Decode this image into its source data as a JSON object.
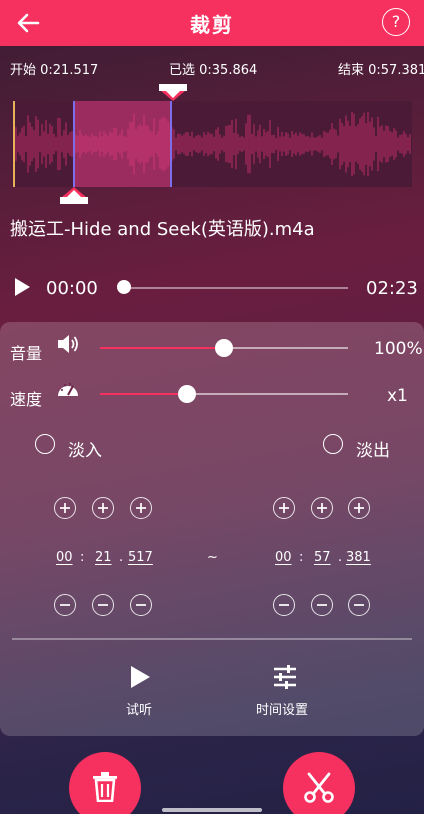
{
  "header": {
    "title": "裁剪",
    "help_label": "?"
  },
  "times": {
    "start": "开始 0:21.517",
    "selected": "已选 0:35.864",
    "end": "结束 0:57.381"
  },
  "file": {
    "name": "搬运工-Hide and Seek(英语版).m4a"
  },
  "player": {
    "current": "00:00",
    "total": "02:23",
    "progress": 0.0
  },
  "volume": {
    "label": "音量",
    "value": "100%",
    "level": 0.5
  },
  "speed": {
    "label": "速度",
    "value": "x1",
    "level": 0.35
  },
  "fade_in": {
    "label": "淡入",
    "checked": false
  },
  "fade_out": {
    "label": "淡出",
    "checked": false
  },
  "start_time": {
    "hh": "00",
    "mm": "21",
    "ms": "517"
  },
  "end_time": {
    "hh": "00",
    "mm": "57",
    "ms": "381"
  },
  "time_separator": "~",
  "actions": {
    "preview": "试听",
    "time_settings": "时间设置"
  },
  "colors": {
    "accent": "#f6305f",
    "selection": "#de3c82",
    "marker": "#e8b25a"
  }
}
